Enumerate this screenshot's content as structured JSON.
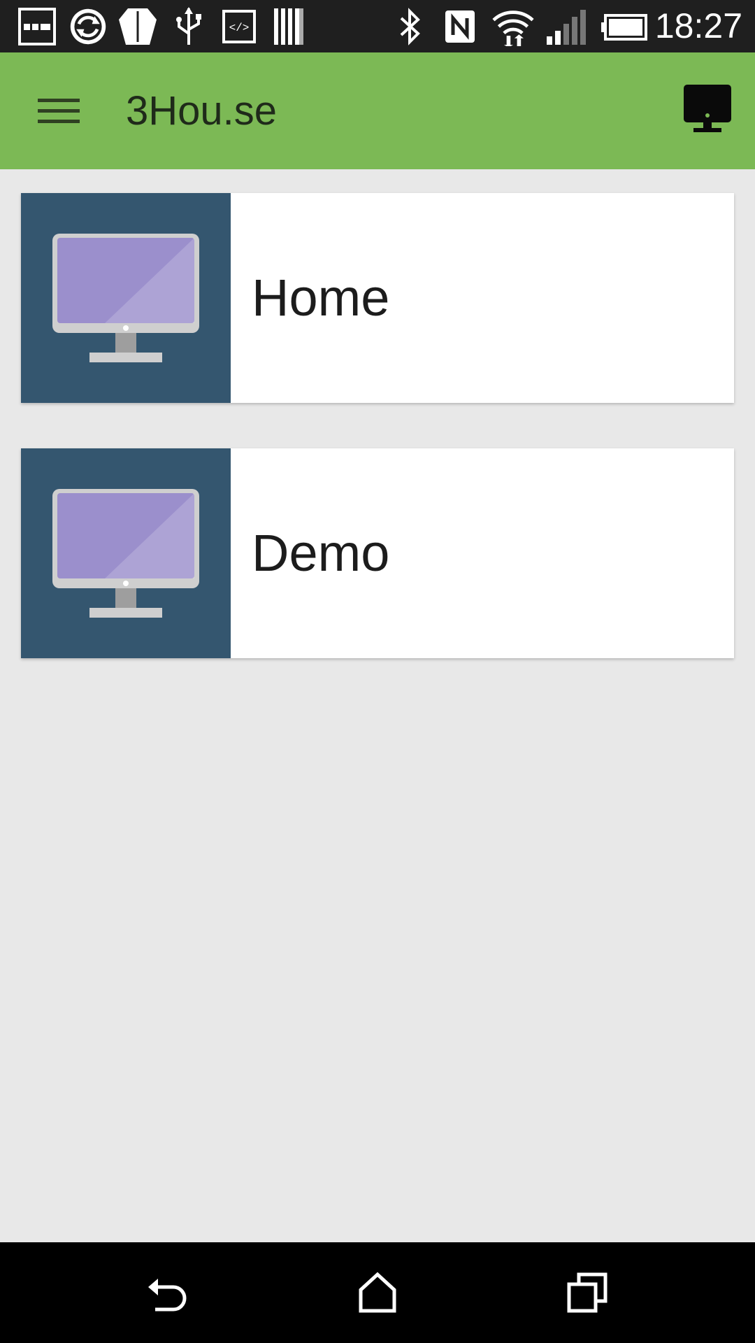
{
  "status_bar": {
    "time": "18:27",
    "icons": [
      "notification-icon",
      "sync-icon",
      "shield-icon",
      "usb-icon",
      "developer-icon",
      "storage-icon",
      "bluetooth-icon",
      "nfc-icon",
      "wifi-icon",
      "signal-icon",
      "battery-icon"
    ]
  },
  "app_bar": {
    "title": "3Hou.se",
    "color": "#7cb955"
  },
  "devices": [
    {
      "label": "Home",
      "icon": "monitor-icon"
    },
    {
      "label": "Demo",
      "icon": "monitor-icon"
    }
  ],
  "colors": {
    "thumb_bg": "#34566f",
    "screen": "#9b8fcc",
    "background": "#e8e8e8"
  },
  "nav_bar": {
    "buttons": [
      "back-icon",
      "home-icon",
      "recents-icon"
    ]
  }
}
